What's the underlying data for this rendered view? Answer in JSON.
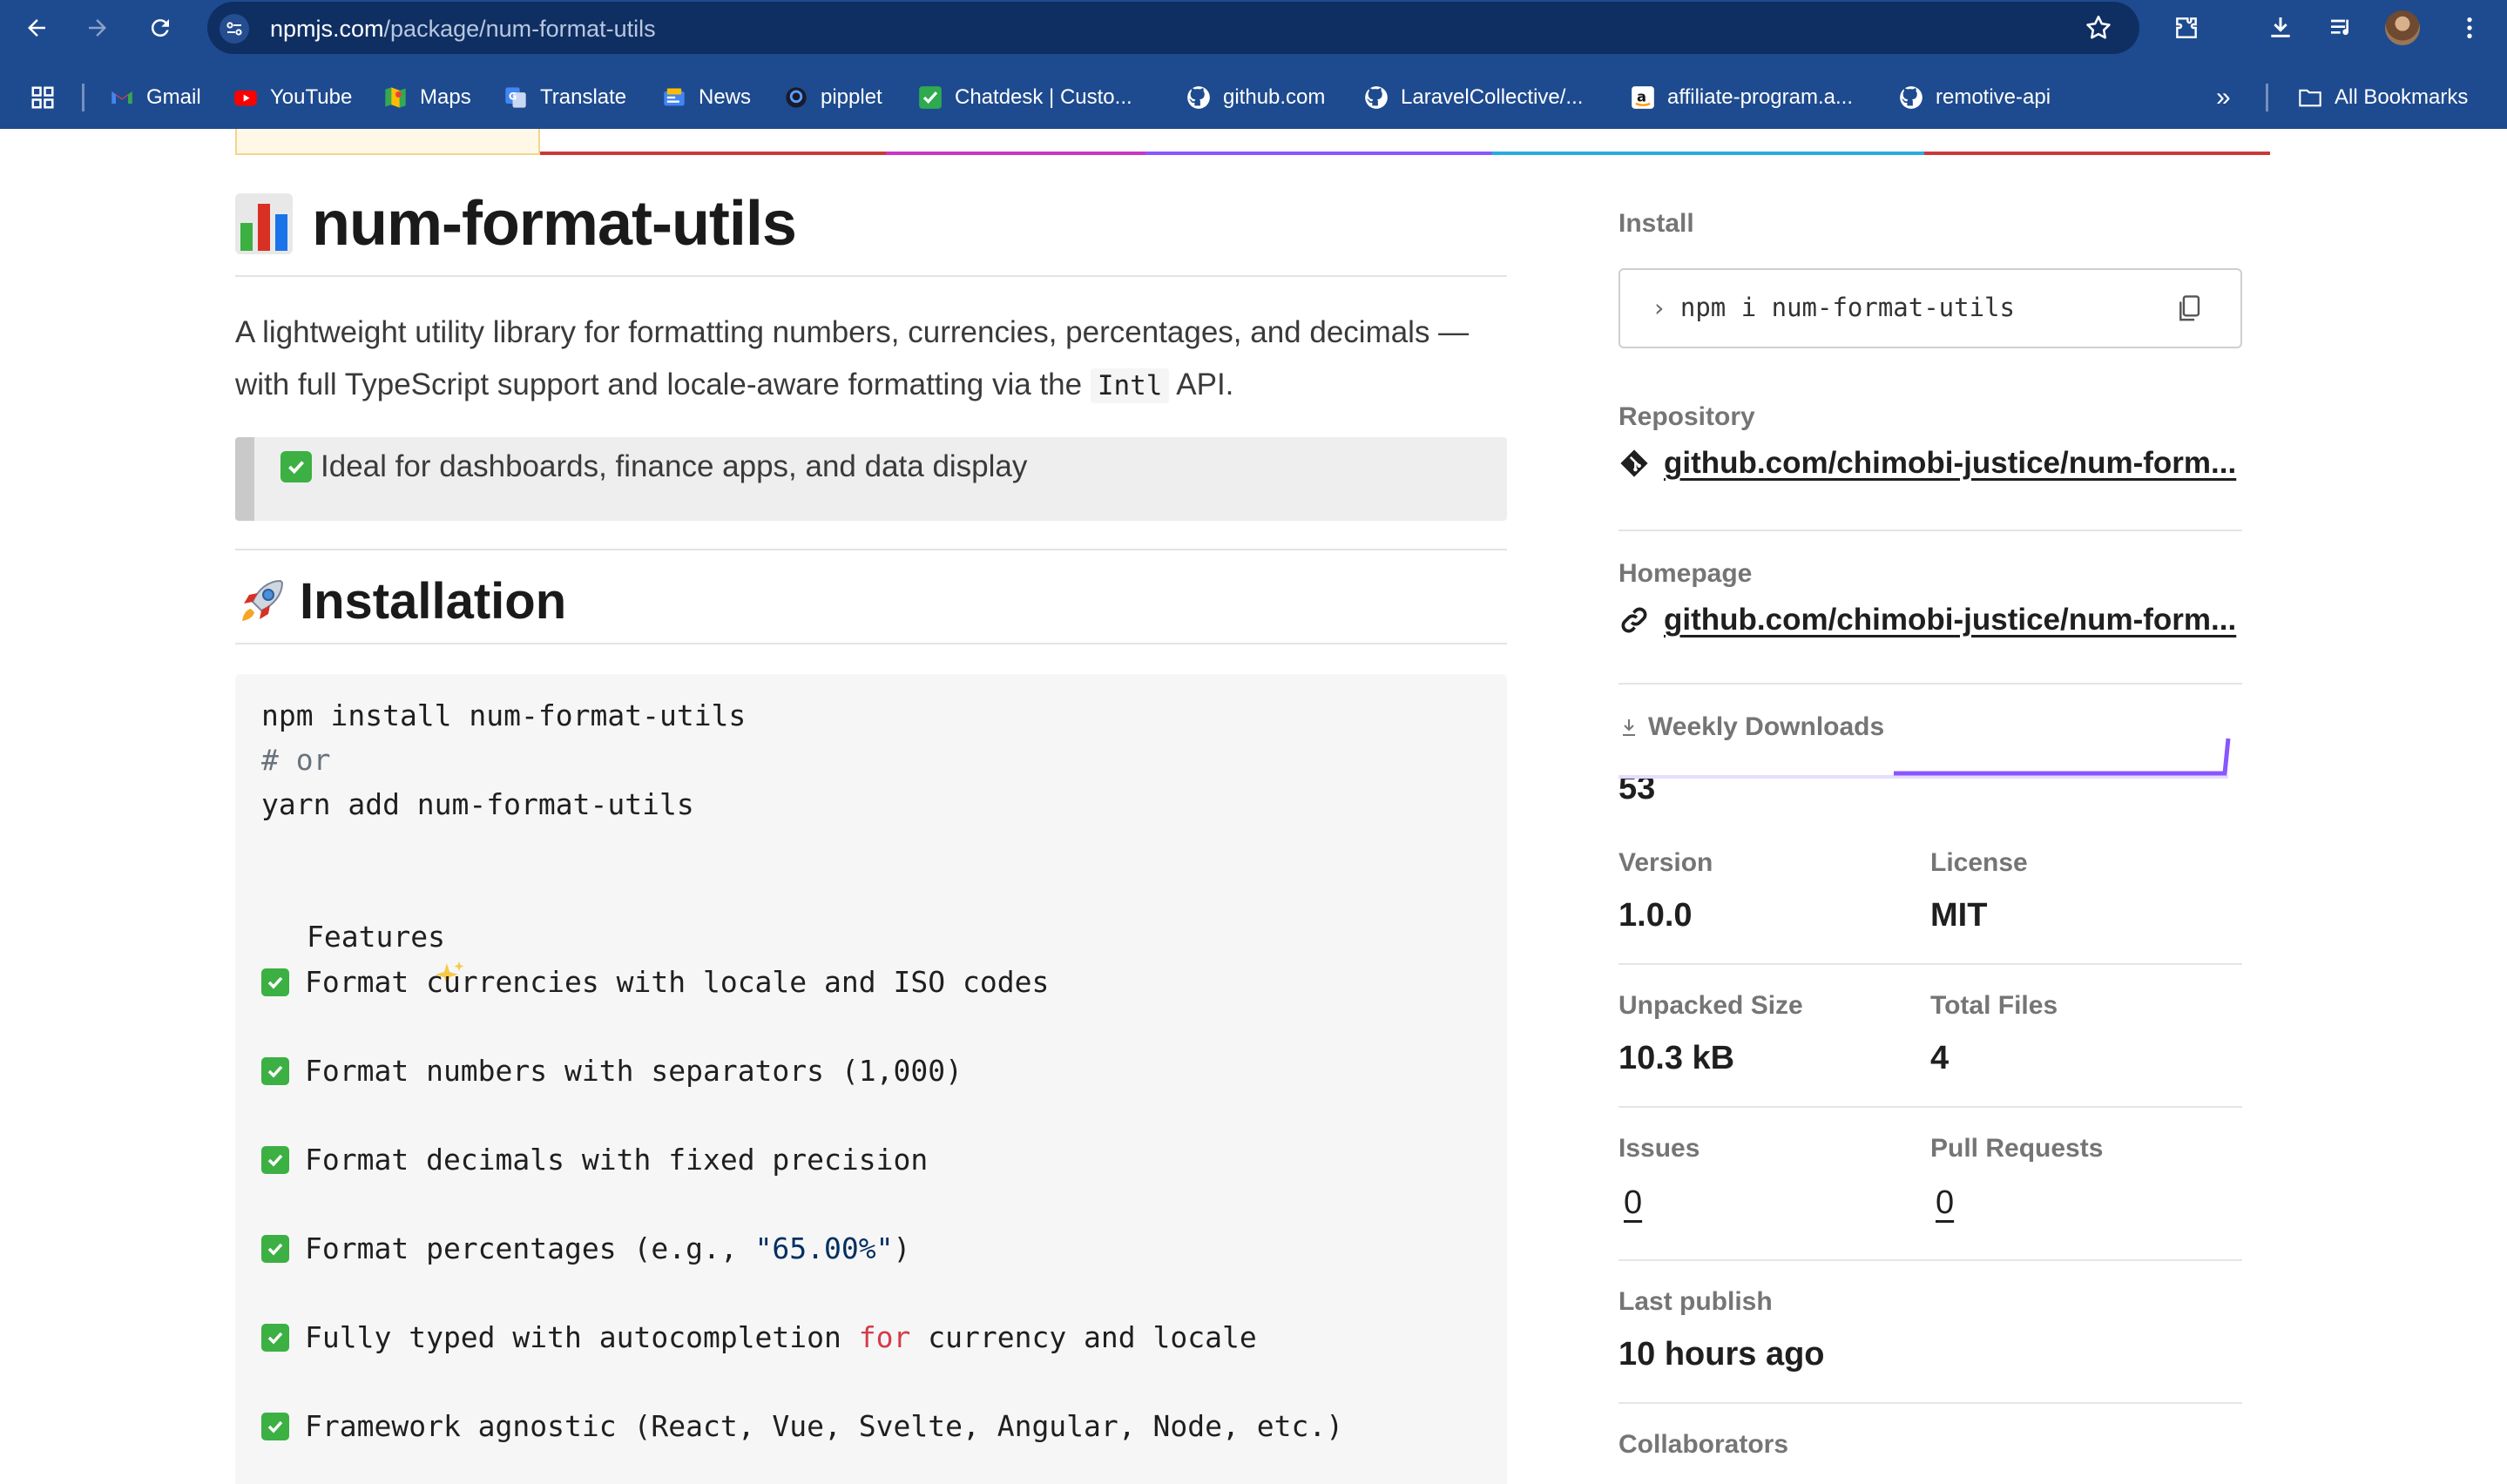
{
  "browser": {
    "url_host": "npmjs.com",
    "url_path": "/package/num-format-utils",
    "bookmarks": [
      {
        "label": "Gmail",
        "icon": "gmail-icon"
      },
      {
        "label": "YouTube",
        "icon": "youtube-icon"
      },
      {
        "label": "Maps",
        "icon": "maps-icon"
      },
      {
        "label": "Translate",
        "icon": "translate-icon"
      },
      {
        "label": "News",
        "icon": "news-icon"
      },
      {
        "label": "pipplet",
        "icon": "pipplet-icon"
      },
      {
        "label": "Chatdesk | Custo...",
        "icon": "chatdesk-icon"
      },
      {
        "label": "github.com",
        "icon": "github-icon"
      },
      {
        "label": "LaravelCollective/...",
        "icon": "github-icon"
      },
      {
        "label": "affiliate-program.a...",
        "icon": "amazon-icon"
      },
      {
        "label": "remotive-api",
        "icon": "github-icon"
      }
    ],
    "all_bookmarks": "All Bookmarks",
    "more_bookmarks": "»"
  },
  "readme": {
    "title": "num-format-utils",
    "description_part1": "A lightweight utility library for formatting numbers, currencies, percentages, and decimals —",
    "description_part2": "with full TypeScript support and locale-aware formatting via the",
    "description_code": "Intl",
    "description_part3": "API.",
    "callout": "Ideal for dashboards, finance apps, and data display",
    "installation_heading": "Installation",
    "code": {
      "line1": "npm install num-format-utils",
      "line2": "# or",
      "line3": "yarn add num-format-utils",
      "features_label": "Features",
      "feature1": "Format currencies with locale and ISO codes",
      "feature2": "Format numbers with separators (1,000)",
      "feature3": "Format decimals with fixed precision",
      "feature4_pre": "Format percentages (e.g., ",
      "feature4_str": "\"65.00%\"",
      "feature4_post": ")",
      "feature5_pre": "Fully typed with autocompletion ",
      "feature5_kw": "for",
      "feature5_post": " currency and locale",
      "feature6": "Framework agnostic (React, Vue, Svelte, Angular, Node, etc.)"
    }
  },
  "sidebar": {
    "install_label": "Install",
    "install_command": "npm i num-format-utils",
    "repository_label": "Repository",
    "repository_link": "github.com/chimobi-justice/num-form...",
    "homepage_label": "Homepage",
    "homepage_link": "github.com/chimobi-justice/num-form...",
    "weekly_downloads_label": "Weekly Downloads",
    "weekly_downloads": "53",
    "version_label": "Version",
    "version": "1.0.0",
    "license_label": "License",
    "license": "MIT",
    "unpacked_size_label": "Unpacked Size",
    "unpacked_size": "10.3 kB",
    "total_files_label": "Total Files",
    "total_files": "4",
    "issues_label": "Issues",
    "issues": "0",
    "pull_requests_label": "Pull Requests",
    "pull_requests": "0",
    "last_publish_label": "Last publish",
    "last_publish": "10 hours ago",
    "collaborators_label": "Collaborators"
  },
  "colors": {
    "chrome": "#1e4b8f",
    "sparkline": "#8956ff",
    "npm_red": "#cb3837"
  }
}
